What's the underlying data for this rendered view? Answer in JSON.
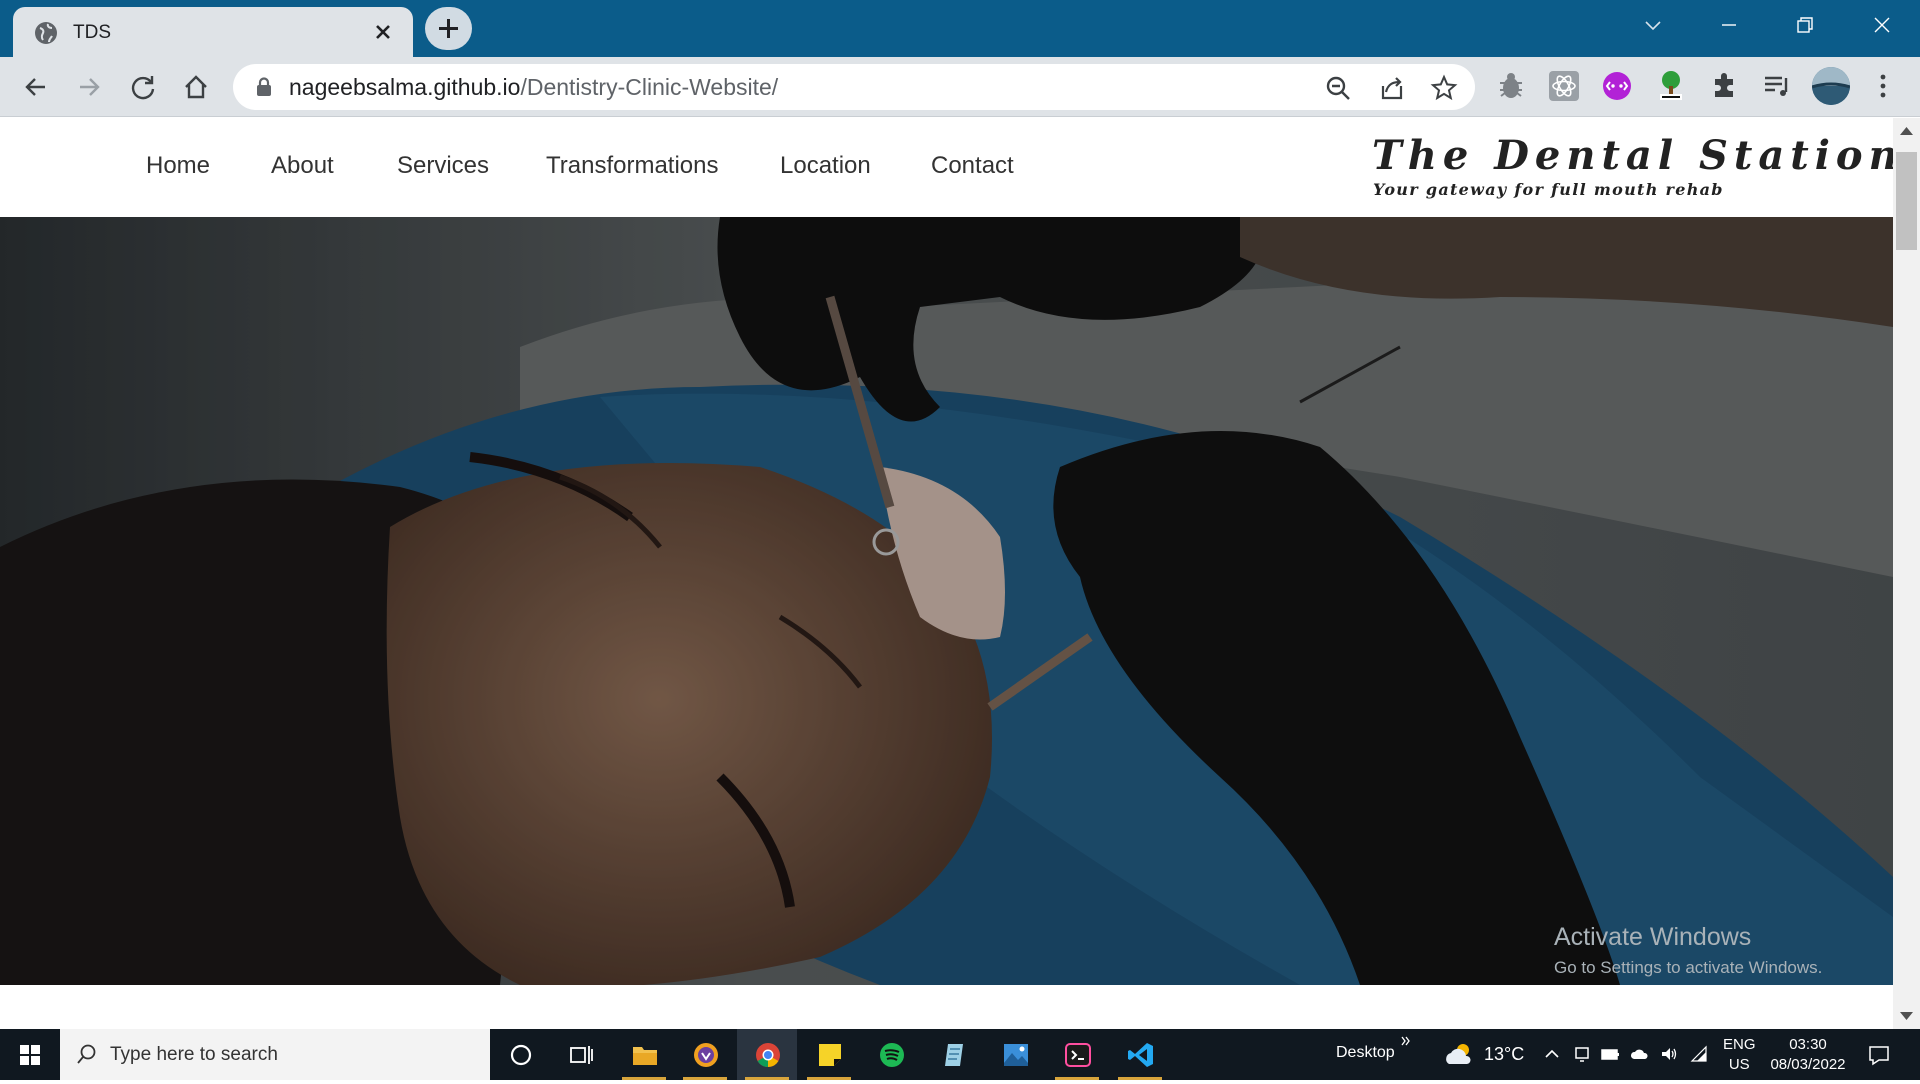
{
  "browser": {
    "tab_title": "TDS",
    "url_host": "nageebsalma.github.io",
    "url_path": "/Dentistry-Clinic-Website/"
  },
  "site": {
    "nav": [
      "Home",
      "About",
      "Services",
      "Transformations",
      "Location",
      "Contact"
    ],
    "brand_title": "The Dental Station",
    "brand_tagline": "Your gateway for full mouth rehab"
  },
  "overlay": {
    "activate_title": "Activate Windows",
    "activate_sub": "Go to Settings to activate Windows."
  },
  "taskbar": {
    "search_placeholder": "Type here to search",
    "desktop_label": "Desktop",
    "temperature": "13°C",
    "lang_line1": "ENG",
    "lang_line2": "US",
    "time": "03:30",
    "date": "08/03/2022"
  },
  "colors": {
    "titlebar": "#0b5c8a",
    "chrome": "#dfe3e7",
    "taskbar": "#101820"
  }
}
